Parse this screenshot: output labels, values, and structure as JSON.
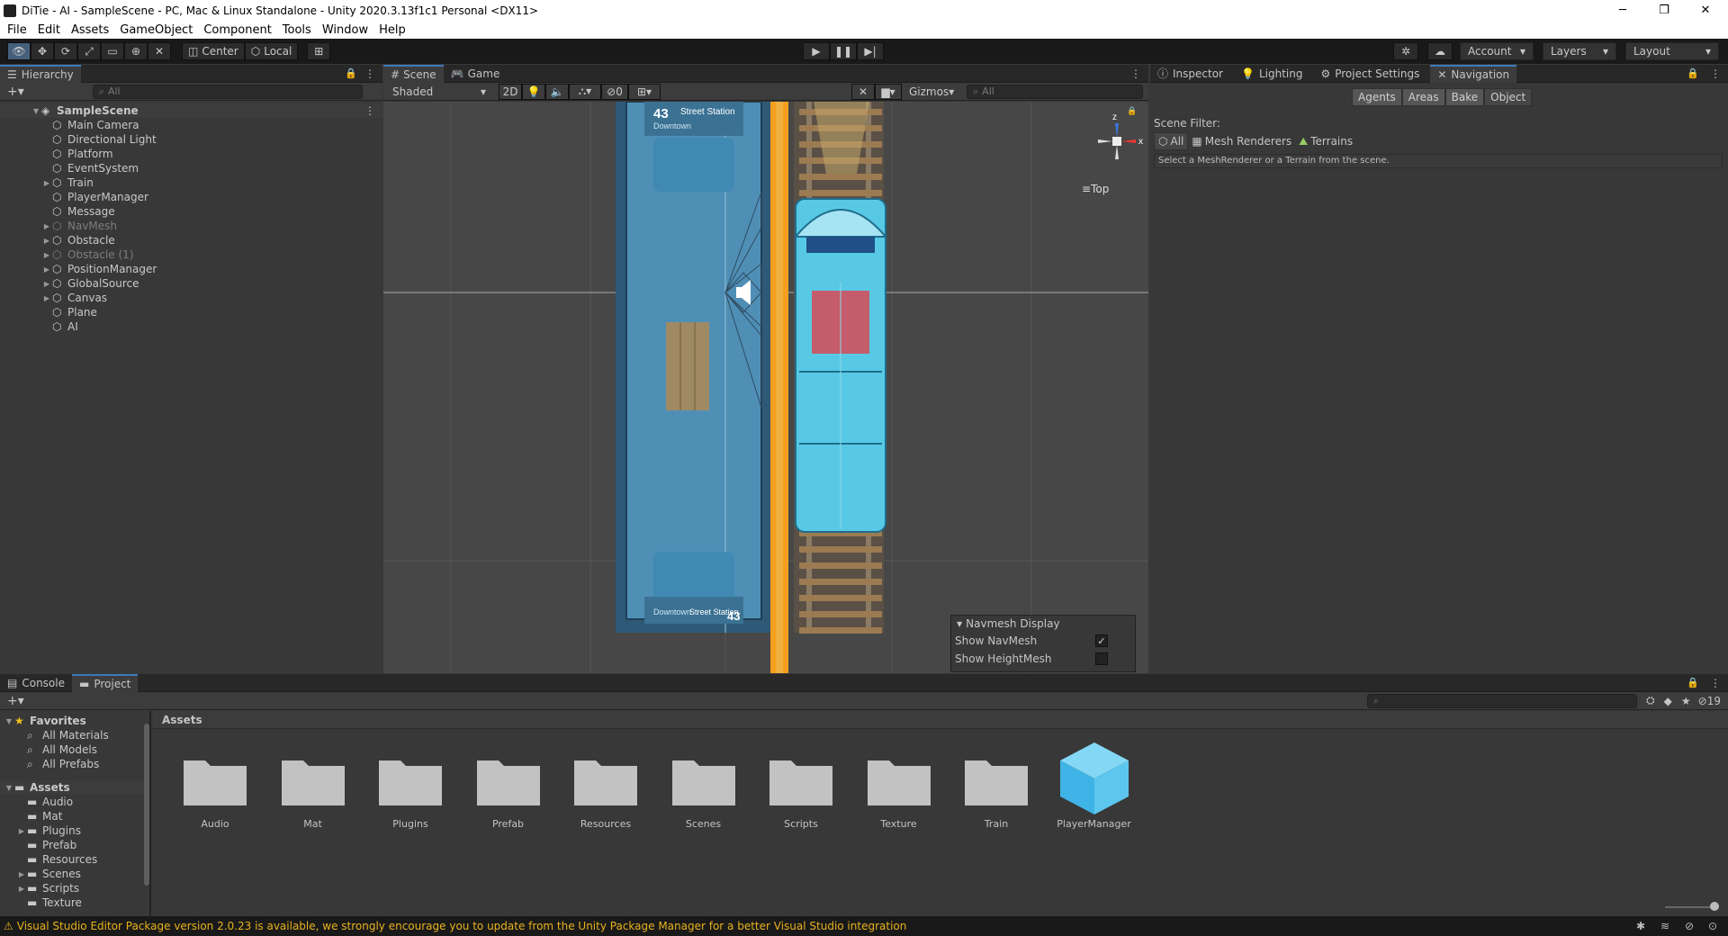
{
  "window": {
    "title": "DiTie - AI - SampleScene - PC, Mac & Linux Standalone - Unity 2020.3.13f1c1 Personal <DX11>",
    "minimize": "─",
    "maximize": "❐",
    "close": "✕"
  },
  "menu": [
    "File",
    "Edit",
    "Assets",
    "GameObject",
    "Component",
    "Tools",
    "Window",
    "Help"
  ],
  "toolbar": {
    "pivot": "Center",
    "space": "Local",
    "account": "Account",
    "layers": "Layers",
    "layout": "Layout"
  },
  "hierarchy": {
    "tab": "Hierarchy",
    "search": "All",
    "scene": "SampleScene",
    "items": [
      {
        "label": "Main Camera",
        "exp": false,
        "dim": false
      },
      {
        "label": "Directional Light",
        "exp": false,
        "dim": false
      },
      {
        "label": "Platform",
        "exp": false,
        "dim": false
      },
      {
        "label": "EventSystem",
        "exp": false,
        "dim": false
      },
      {
        "label": "Train",
        "exp": true,
        "dim": false
      },
      {
        "label": "PlayerManager",
        "exp": false,
        "dim": false
      },
      {
        "label": "Message",
        "exp": false,
        "dim": false
      },
      {
        "label": "NavMesh",
        "exp": true,
        "dim": true
      },
      {
        "label": "Obstacle",
        "exp": true,
        "dim": false
      },
      {
        "label": "Obstacle (1)",
        "exp": true,
        "dim": true
      },
      {
        "label": "PositionManager",
        "exp": true,
        "dim": false
      },
      {
        "label": "GlobalSource",
        "exp": true,
        "dim": false
      },
      {
        "label": "Canvas",
        "exp": true,
        "dim": false
      },
      {
        "label": "Plane",
        "exp": false,
        "dim": false
      },
      {
        "label": "AI",
        "exp": false,
        "dim": false
      }
    ]
  },
  "scene": {
    "tab_scene": "Scene",
    "tab_game": "Game",
    "shading": "Shaded",
    "mode2d": "2D",
    "hidden_count": "0",
    "gizmos": "Gizmos",
    "search": "All",
    "view_label": "Top",
    "station_number_top": "43",
    "station_name_top": "Street Station",
    "station_sub_top": "Downtown",
    "station_number_bottom": "43",
    "station_name_bottom": "Street Station",
    "station_sub_bottom": "Downtown",
    "navmesh": {
      "title": "Navmesh Display",
      "show_navmesh": "Show NavMesh",
      "show_heightmesh": "Show HeightMesh"
    }
  },
  "inspector": {
    "tabs": [
      "Inspector",
      "Lighting",
      "Project Settings",
      "Navigation"
    ],
    "nav_tabs": [
      "Agents",
      "Areas",
      "Bake",
      "Object"
    ],
    "scene_filter": "Scene Filter:",
    "filter_all": "All",
    "filter_mesh": "Mesh Renderers",
    "filter_terrains": "Terrains",
    "hint": "Select a MeshRenderer or a Terrain from the scene."
  },
  "project": {
    "tab_console": "Console",
    "tab_project": "Project",
    "path": "Assets",
    "hidden_count": "19",
    "favorites": "Favorites",
    "fav_items": [
      "All Materials",
      "All Models",
      "All Prefabs"
    ],
    "assets_root": "Assets",
    "tree": [
      {
        "label": "Audio",
        "exp": false
      },
      {
        "label": "Mat",
        "exp": false
      },
      {
        "label": "Plugins",
        "exp": true
      },
      {
        "label": "Prefab",
        "exp": false
      },
      {
        "label": "Resources",
        "exp": false
      },
      {
        "label": "Scenes",
        "exp": true
      },
      {
        "label": "Scripts",
        "exp": true
      },
      {
        "label": "Texture",
        "exp": false
      }
    ],
    "grid": [
      "Audio",
      "Mat",
      "Plugins",
      "Prefab",
      "Resources",
      "Scenes",
      "Scripts",
      "Texture",
      "Train"
    ],
    "prefab": "PlayerManager"
  },
  "status": {
    "message": "Visual Studio Editor Package version 2.0.23 is available, we strongly encourage you to update from the Unity Package Manager for a better Visual Studio integration"
  },
  "colors": {
    "accent": "#3a79bb",
    "warning": "#e8b21e",
    "navmesh": "#4f8fb6",
    "train": "#57c9e4"
  }
}
